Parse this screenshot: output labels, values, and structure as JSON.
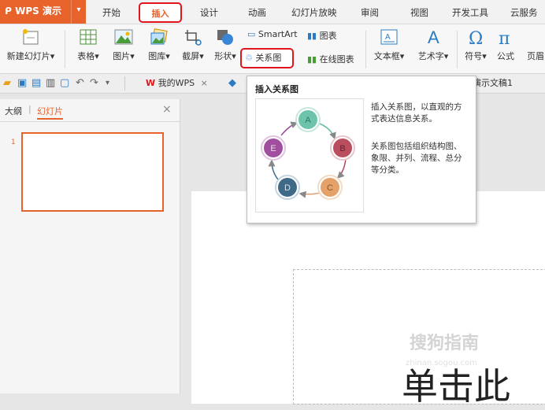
{
  "app": {
    "name": "WPS 演示"
  },
  "menu": {
    "items": [
      "开始",
      "插入",
      "设计",
      "动画",
      "幻灯片放映",
      "审阅",
      "视图",
      "开发工具",
      "云服务"
    ]
  },
  "ribbon": {
    "new_slide": "新建幻灯片",
    "table": "表格",
    "picture": "图片",
    "gallery": "图库",
    "screenshot": "截屏",
    "shape": "形状",
    "smartart": "SmartArt",
    "chart": "图表",
    "relation": "关系图",
    "online_chart": "在线图表",
    "textbox": "文本框",
    "wordart": "艺术字",
    "symbol": "符号",
    "formula": "公式",
    "header": "页眉"
  },
  "quickbar": {
    "tab_wps": "我的WPS",
    "tab_doc": "演示文稿1"
  },
  "left_panel": {
    "tab_outline": "大纲",
    "tab_slides": "幻灯片",
    "slide_number": "1"
  },
  "tooltip": {
    "title": "插入关系图",
    "desc1": "插入关系图，以直观的方式表达信息关系。",
    "desc2": "关系图包括组织结构图、象限、并列、流程、总分等分类。",
    "nodes": [
      "A",
      "B",
      "C",
      "D",
      "E"
    ]
  },
  "canvas": {
    "big_text": "单击此",
    "watermark": "搜狗指南",
    "watermark_url": "zhinan.sogou.com"
  },
  "colors": {
    "accent": "#e8632b",
    "highlight": "#e2141c"
  }
}
